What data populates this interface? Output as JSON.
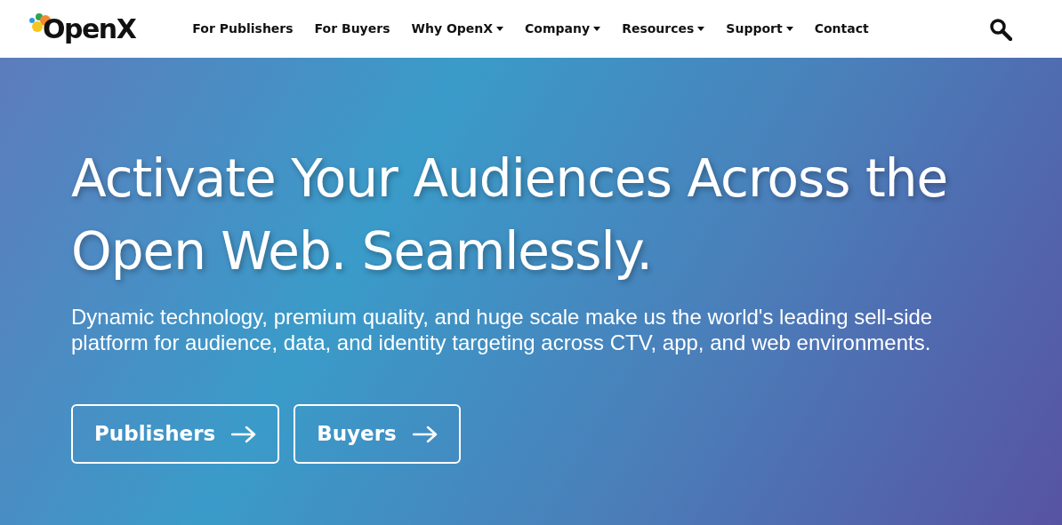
{
  "logo": {
    "text": "OpenX"
  },
  "nav": [
    {
      "label": "For Publishers",
      "dropdown": false
    },
    {
      "label": "For Buyers",
      "dropdown": false
    },
    {
      "label": "Why OpenX",
      "dropdown": true
    },
    {
      "label": "Company",
      "dropdown": true
    },
    {
      "label": "Resources",
      "dropdown": true
    },
    {
      "label": "Support",
      "dropdown": true
    },
    {
      "label": "Contact",
      "dropdown": false
    }
  ],
  "hero": {
    "heading": "Activate Your Audiences Across the Open Web. Seamlessly.",
    "subheading": "Dynamic technology, premium quality, and huge scale make us the world's leading sell-side platform for audience, data, and identity targeting across CTV, app, and web environments.",
    "buttons": [
      {
        "label": "Publishers"
      },
      {
        "label": "Buyers"
      }
    ]
  }
}
